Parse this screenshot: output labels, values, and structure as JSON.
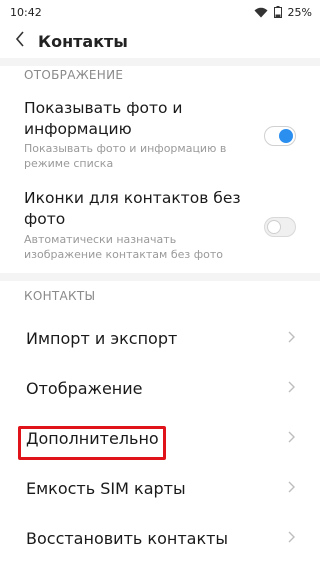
{
  "status_bar": {
    "time": "10:42",
    "battery": "25%",
    "icons": [
      "wifi-icon",
      "battery-icon"
    ]
  },
  "header": {
    "title": "Контакты",
    "back_icon": "back-arrow-icon"
  },
  "display_section": {
    "header": "ОТОБРАЖЕНИЕ",
    "items": [
      {
        "title": "Показывать фото и информацию",
        "subtitle": "Показывать фото и информацию в режиме списка",
        "enabled": true
      },
      {
        "title": "Иконки для контактов без фото",
        "subtitle": "Автоматически назначать изображение контактам без фото",
        "enabled": false
      }
    ]
  },
  "contacts_section": {
    "header": "КОНТАКТЫ",
    "items": [
      {
        "label": "Импорт и экспорт"
      },
      {
        "label": "Отображение"
      },
      {
        "label": "Дополнительно"
      },
      {
        "label": "Емкость SIM карты"
      },
      {
        "label": "Восстановить контакты"
      }
    ]
  },
  "colors": {
    "accent": "#2b8ff0",
    "highlight": "#e0131a",
    "section_header": "#8a8a8a"
  }
}
